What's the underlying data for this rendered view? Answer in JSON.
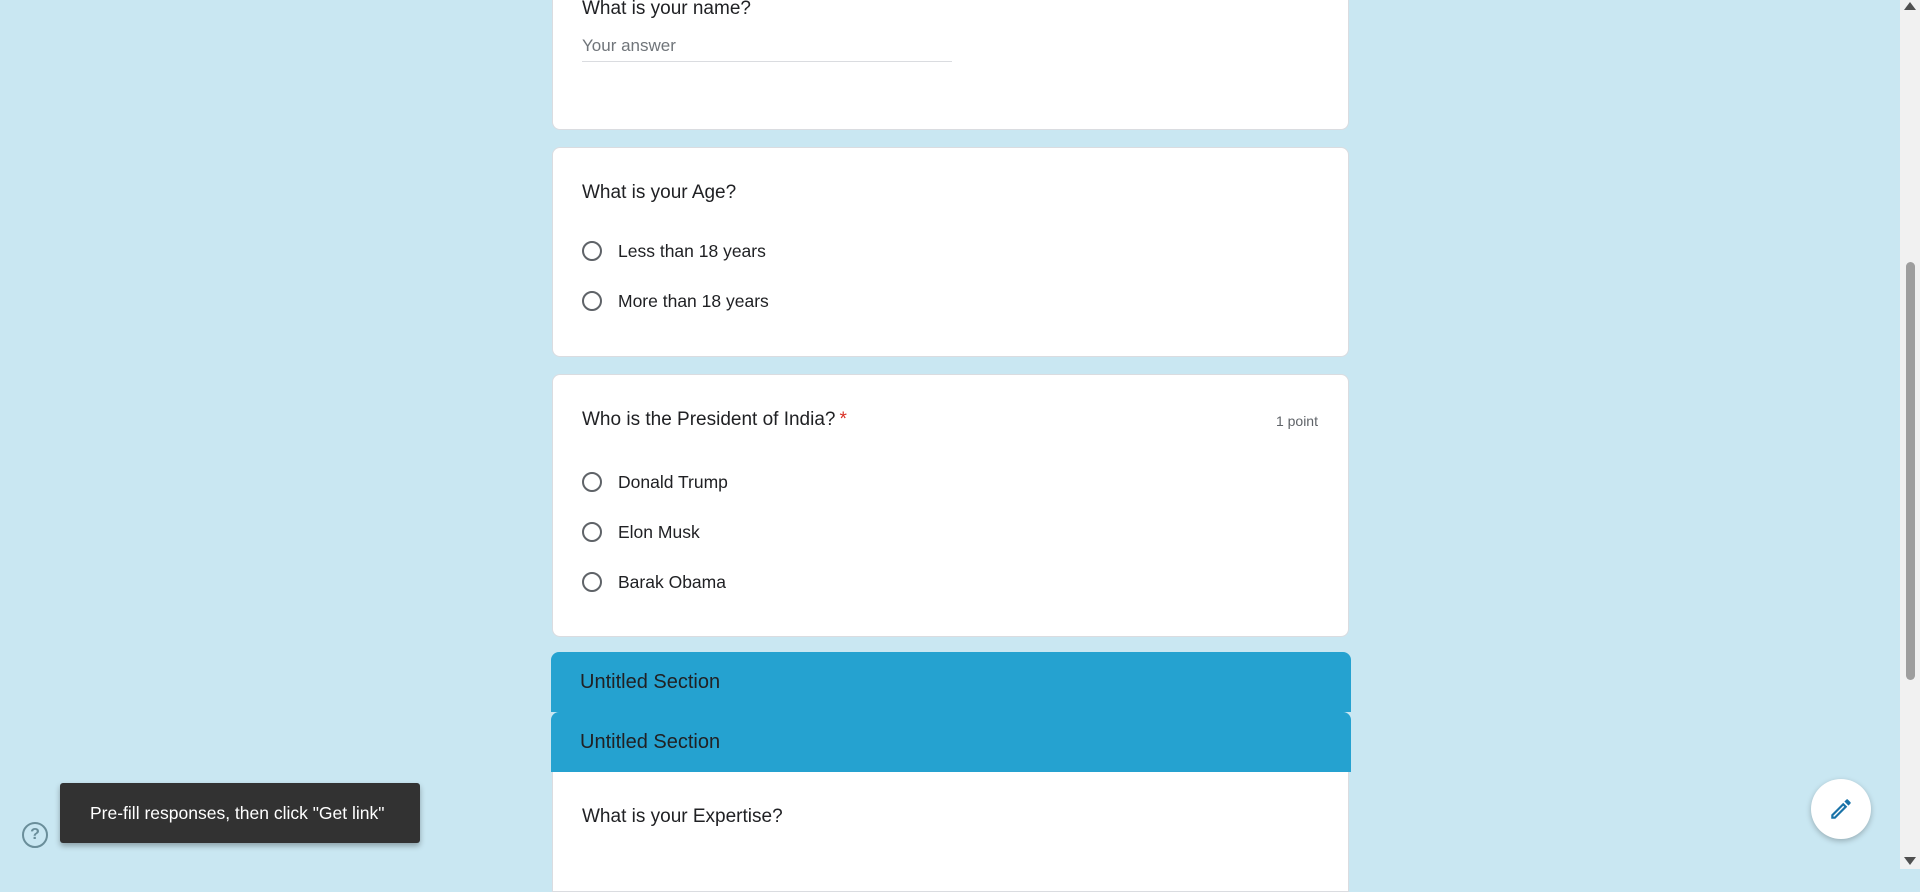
{
  "colors": {
    "page_background": "#c9e7f2",
    "section_header": "#25a2d0",
    "required_star": "#d93025",
    "toast_background": "#323232"
  },
  "questions": {
    "name": {
      "title": "What is your name?",
      "placeholder": "Your answer"
    },
    "age": {
      "title": "What is your Age?",
      "options": [
        "Less than 18 years",
        "More than 18 years"
      ]
    },
    "president": {
      "title": "Who is the President of India?",
      "required_marker": "*",
      "points": "1 point",
      "options": [
        "Donald Trump",
        "Elon Musk",
        "Barak Obama"
      ]
    },
    "expertise": {
      "title": "What is your Expertise?"
    }
  },
  "sections": [
    {
      "title": "Untitled Section"
    },
    {
      "title": "Untitled Section"
    }
  ],
  "toast": {
    "message": "Pre-fill responses, then click \"Get link\""
  },
  "icons": {
    "help": "help-icon",
    "fab": "pencil-edit-icon"
  }
}
